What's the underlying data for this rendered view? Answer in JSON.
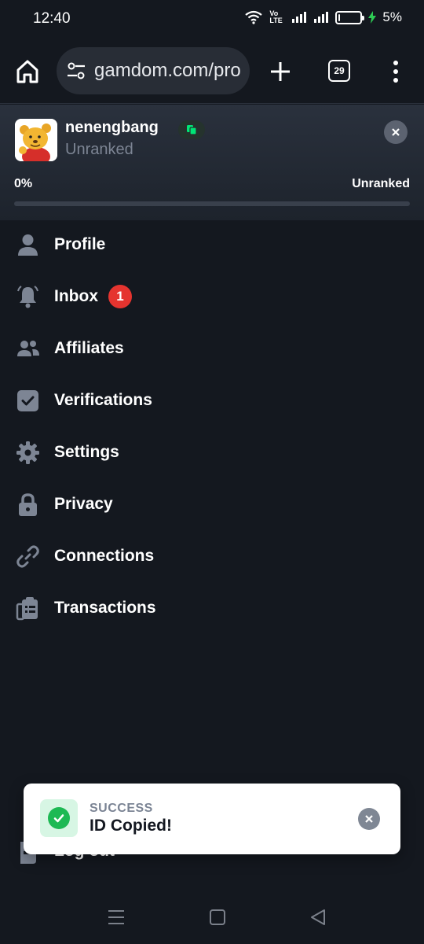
{
  "status_bar": {
    "time": "12:40",
    "battery_percent": "5%",
    "battery_level": 0.05,
    "icons": [
      "wifi-icon",
      "volte-icon",
      "signal-icon",
      "signal-icon",
      "battery-icon",
      "charging-icon"
    ],
    "volte_label": "Vo LTE"
  },
  "browser": {
    "url": "gamdom.com/pro",
    "tab_count": "29",
    "icons": [
      "home-icon",
      "tune-icon",
      "plus-icon",
      "more-vertical-icon"
    ]
  },
  "profile": {
    "username": "nenengbang",
    "rank": "Unranked",
    "progress_label": "0%",
    "progress_target": "Unranked",
    "progress": 0,
    "copy_color": "#00e676"
  },
  "menu": {
    "items": [
      {
        "label": "Profile",
        "icon": "user-icon"
      },
      {
        "label": "Inbox",
        "icon": "bell-icon",
        "badge": "1"
      },
      {
        "label": "Affiliates",
        "icon": "users-icon"
      },
      {
        "label": "Verifications",
        "icon": "check-square-icon"
      },
      {
        "label": "Settings",
        "icon": "gear-icon"
      },
      {
        "label": "Privacy",
        "icon": "lock-icon"
      },
      {
        "label": "Connections",
        "icon": "link-icon"
      },
      {
        "label": "Transactions",
        "icon": "clipboard-list-icon"
      }
    ],
    "logout_label": "Log out"
  },
  "toast": {
    "title": "SUCCESS",
    "message": "ID Copied!",
    "accent": "#1db954"
  },
  "colors": {
    "background": "#14181f",
    "badge": "#e5342f",
    "icon": "#7d8594"
  }
}
